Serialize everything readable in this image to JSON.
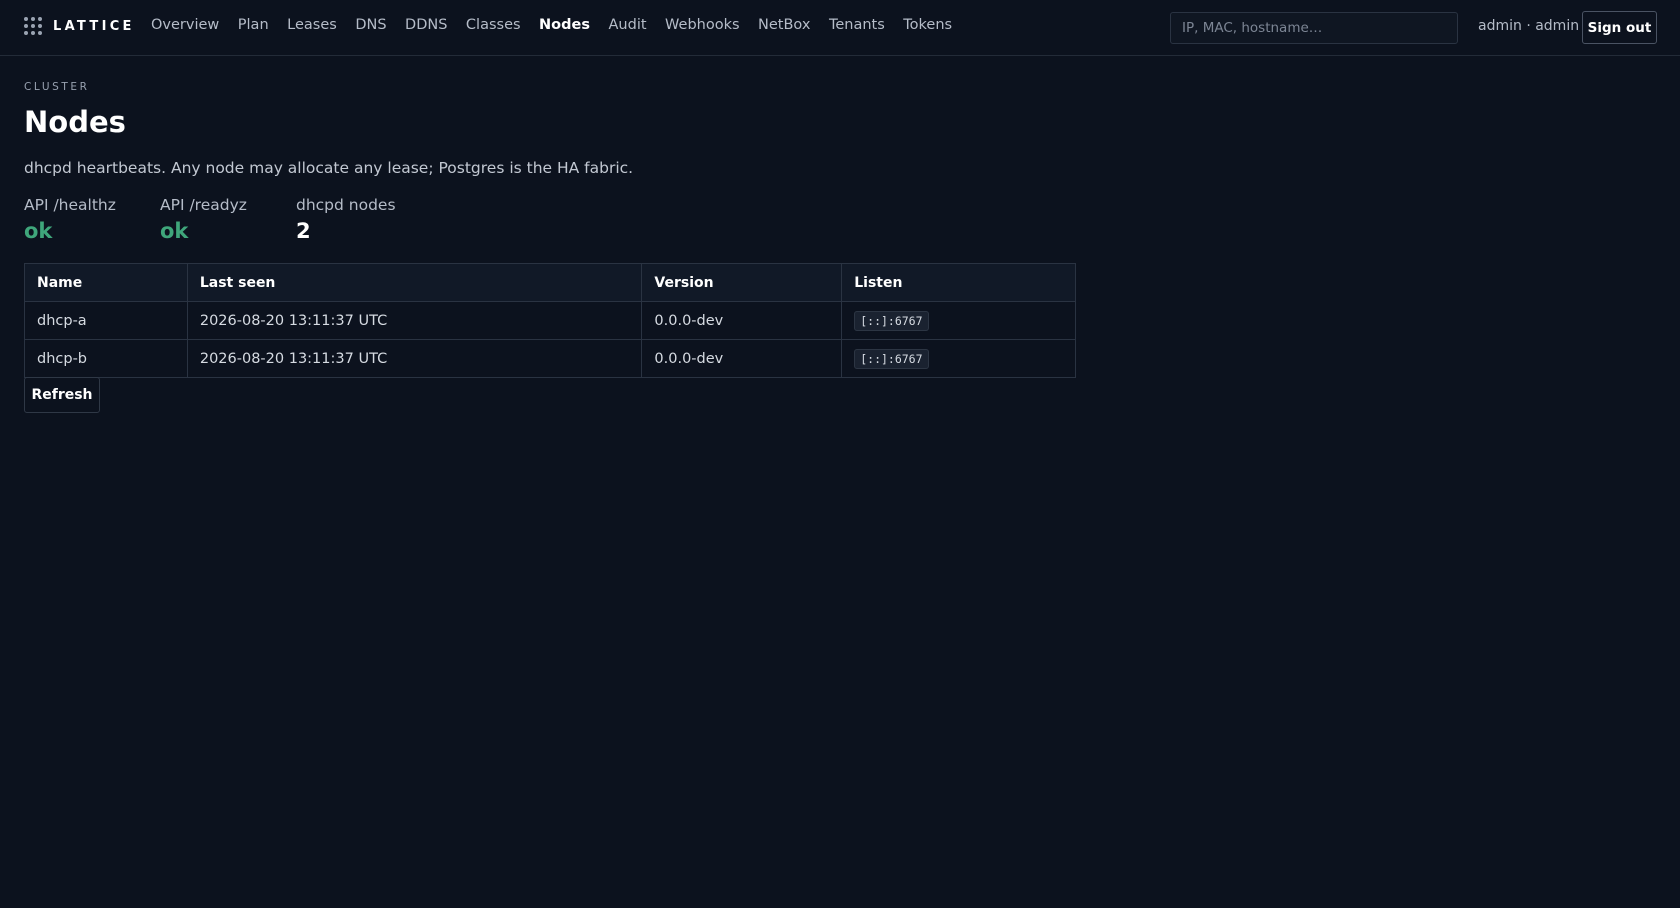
{
  "brand": {
    "name": "LATTICE",
    "icon": "grid-dots-icon"
  },
  "nav": {
    "items": [
      {
        "label": "Overview"
      },
      {
        "label": "Plan"
      },
      {
        "label": "Leases"
      },
      {
        "label": "DNS"
      },
      {
        "label": "DDNS"
      },
      {
        "label": "Classes"
      },
      {
        "label": "Nodes",
        "active": true
      },
      {
        "label": "Audit"
      },
      {
        "label": "Webhooks"
      },
      {
        "label": "NetBox"
      },
      {
        "label": "Tenants"
      },
      {
        "label": "Tokens"
      }
    ]
  },
  "search": {
    "placeholder": "IP, MAC, hostname…",
    "value": ""
  },
  "user": {
    "label": "admin · admin"
  },
  "signout_label": "Sign out",
  "page": {
    "eyebrow": "CLUSTER",
    "title": "Nodes",
    "subtitle": "dhcpd heartbeats. Any node may allocate any lease; Postgres is the HA fabric."
  },
  "stats": [
    {
      "label": "API /healthz",
      "value": "ok",
      "kind": "ok"
    },
    {
      "label": "API /readyz",
      "value": "ok",
      "kind": "ok"
    },
    {
      "label": "dhcpd nodes",
      "value": "2",
      "kind": "num"
    }
  ],
  "table": {
    "columns": [
      "Name",
      "Last seen",
      "Version",
      "Listen"
    ],
    "rows": [
      [
        "dhcp-a",
        "2026-08-20 13:11:37 UTC",
        "0.0.0-dev",
        "[::]:6767"
      ],
      [
        "dhcp-b",
        "2026-08-20 13:11:37 UTC",
        "0.0.0-dev",
        "[::]:6767"
      ]
    ]
  },
  "refresh_label": "Refresh",
  "colors": {
    "background": "#0c121e",
    "ok": "#3fa67b",
    "border": "#2a3342"
  }
}
